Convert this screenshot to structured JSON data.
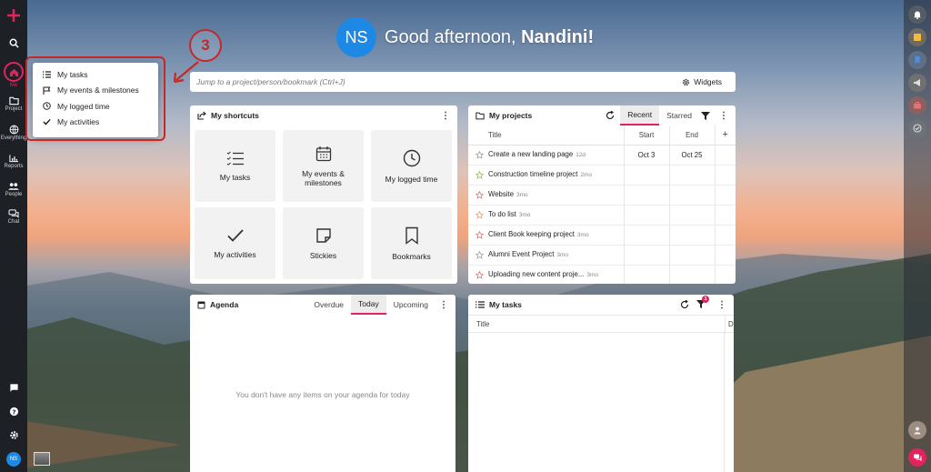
{
  "sidebar": {
    "items": [
      {
        "label": "Me",
        "icon": "home-icon"
      },
      {
        "label": "Project",
        "icon": "folder-icon"
      },
      {
        "label": "Everything",
        "icon": "globe-icon"
      },
      {
        "label": "Reports",
        "icon": "bar-chart-icon"
      },
      {
        "label": "People",
        "icon": "people-icon"
      },
      {
        "label": "Chat",
        "icon": "chat-icon"
      }
    ],
    "avatar_initials": "NS"
  },
  "menu": {
    "items": [
      {
        "label": "My tasks",
        "icon": "list-icon"
      },
      {
        "label": "My events & milestones",
        "icon": "flag-icon"
      },
      {
        "label": "My logged time",
        "icon": "clock-icon"
      },
      {
        "label": "My activities",
        "icon": "check-icon"
      }
    ]
  },
  "callout": {
    "number": "3"
  },
  "header": {
    "avatar_initials": "NS",
    "greeting": "Good afternoon, ",
    "name": "Nandini!"
  },
  "search": {
    "placeholder": "Jump to a project/person/bookmark (Ctrl+J)",
    "widgets_label": "Widgets"
  },
  "shortcuts": {
    "title": "My shortcuts",
    "tiles": [
      {
        "label": "My tasks",
        "icon": "task-list-icon"
      },
      {
        "label": "My events & milestones",
        "icon": "calendar-icon"
      },
      {
        "label": "My logged time",
        "icon": "clock-icon"
      },
      {
        "label": "My activities",
        "icon": "check-icon"
      },
      {
        "label": "Stickies",
        "icon": "sticky-note-icon"
      },
      {
        "label": "Bookmarks",
        "icon": "bookmark-icon"
      }
    ]
  },
  "projects": {
    "title": "My projects",
    "tabs": [
      "Recent",
      "Starred"
    ],
    "columns": [
      "Title",
      "Start",
      "End"
    ],
    "rows": [
      {
        "title": "Create a new landing page",
        "ago": "12d",
        "start": "Oct 3",
        "end": "Oct 25",
        "star_color": "#9e9e9e"
      },
      {
        "title": "Construction timeline project",
        "ago": "2mo",
        "start": "",
        "end": "",
        "star_color": "#8bc34a"
      },
      {
        "title": "Website",
        "ago": "3mo",
        "start": "",
        "end": "",
        "star_color": "#e57373"
      },
      {
        "title": "To do list",
        "ago": "3mo",
        "start": "",
        "end": "",
        "star_color": "#f0a060"
      },
      {
        "title": "Client Book keeping project",
        "ago": "3mo",
        "start": "",
        "end": "",
        "star_color": "#e57373"
      },
      {
        "title": "Alumni Event Project",
        "ago": "3mo",
        "start": "",
        "end": "",
        "star_color": "#9e9e9e"
      },
      {
        "title": "Uploading new content proje...",
        "ago": "3mo",
        "start": "",
        "end": "",
        "star_color": "#e57373"
      }
    ]
  },
  "agenda": {
    "title": "Agenda",
    "tabs": [
      "Overdue",
      "Today",
      "Upcoming"
    ],
    "empty_text": "You don't have any items on your agenda for today"
  },
  "tasks": {
    "title": "My tasks",
    "filter_badge": "1",
    "columns": [
      "Title",
      "D"
    ]
  },
  "colors": {
    "accent": "#e0245e",
    "avatar": "#1e88e5",
    "sidebar": "#1d2025"
  }
}
